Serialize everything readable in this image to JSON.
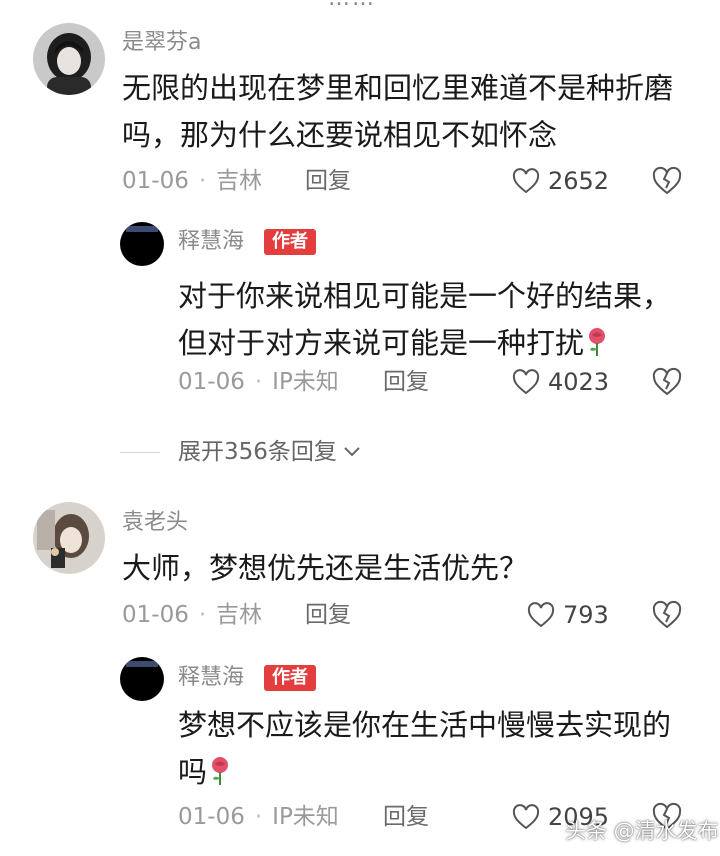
{
  "top_partial_text": "……",
  "comments": [
    {
      "user": "是翠芬a",
      "text": "无限的出现在梦里和回忆里难道不是种折磨吗，那为什么还要说相见不如怀念",
      "date": "01-06",
      "location": "吉林",
      "reply_label": "回复",
      "likes": "2652",
      "avatar_icon": "avatar-dark-hair"
    },
    {
      "user": "释慧海",
      "badge": "作者",
      "text": "对于你来说相见可能是一个好的结果，但对于对方来说可能是一种打扰",
      "emoji": "rose-icon",
      "date": "01-06",
      "location": "IP未知",
      "reply_label": "回复",
      "likes": "4023",
      "avatar_icon": "avatar-black"
    },
    {
      "user": "袁老头",
      "text": "大师，梦想优先还是生活优先？",
      "date": "01-06",
      "location": "吉林",
      "reply_label": "回复",
      "likes": "793",
      "avatar_icon": "avatar-photo"
    },
    {
      "user": "释慧海",
      "badge": "作者",
      "text": "梦想不应该是你在生活中慢慢去实现的吗",
      "emoji": "rose-icon",
      "date": "01-06",
      "location": "IP未知",
      "reply_label": "回复",
      "likes": "2095",
      "avatar_icon": "avatar-black"
    }
  ],
  "expand_replies": "展开356条回复",
  "watermark": "头条 @清水发布",
  "colors": {
    "badge": "#e33d3d",
    "muted": "#9a9a9a"
  }
}
